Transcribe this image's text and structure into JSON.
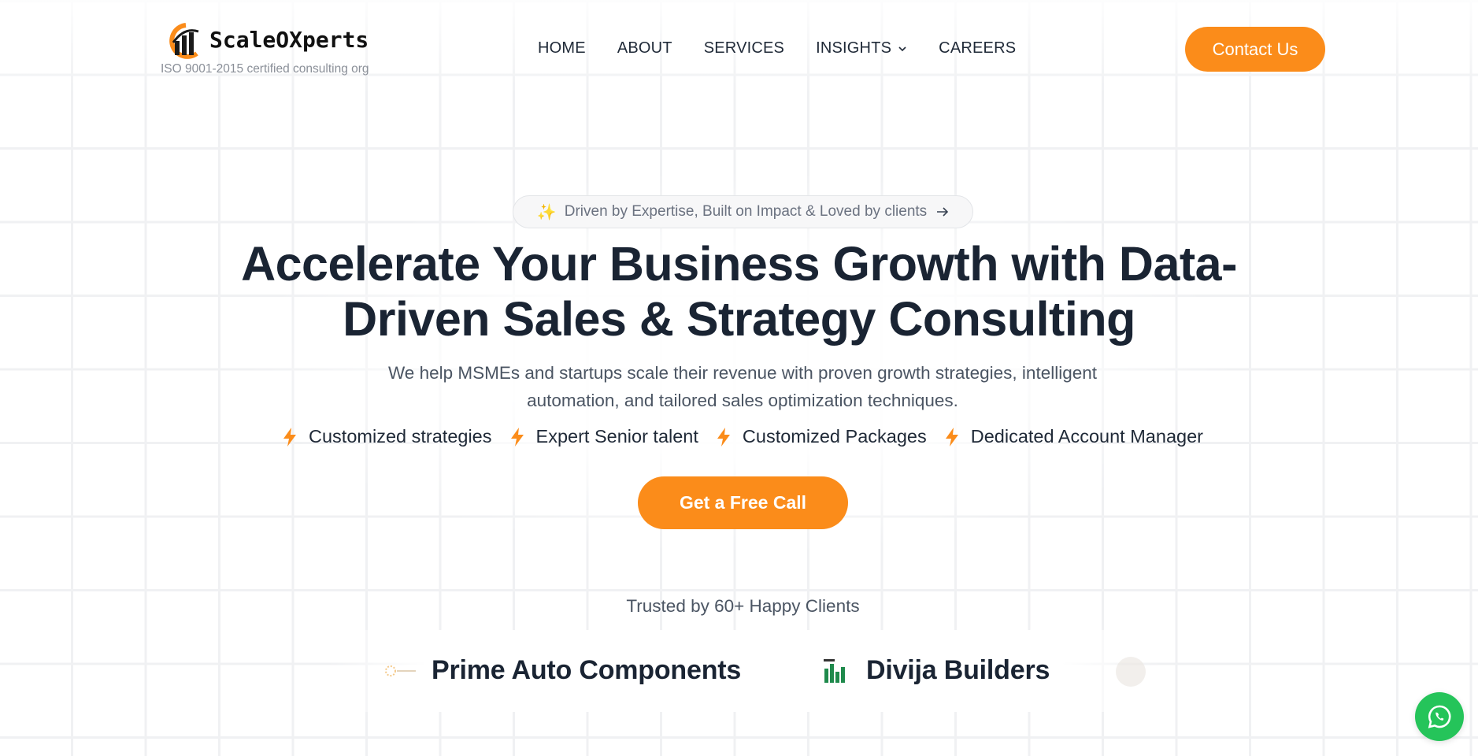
{
  "header": {
    "logo_text": "ScaleOXperts",
    "tagline": "ISO 9001-2015 certified consulting org",
    "nav": [
      {
        "label": "HOME"
      },
      {
        "label": "ABOUT"
      },
      {
        "label": "SERVICES"
      },
      {
        "label": "INSIGHTS",
        "has_dropdown": true
      },
      {
        "label": "CAREERS"
      }
    ],
    "contact_label": "Contact Us"
  },
  "hero": {
    "pill_text": "Driven by Expertise, Built on Impact & Loved by clients",
    "headline_line1": "Accelerate Your Business Growth with Data-",
    "headline_line2": "Driven Sales & Strategy Consulting",
    "subtext_line1": "We help MSMEs and startups scale their revenue with proven growth strategies, intelligent",
    "subtext_line2": "automation, and tailored sales optimization techniques.",
    "features": [
      {
        "label": "Customized strategies"
      },
      {
        "label": "Expert Senior talent"
      },
      {
        "label": "Customized Packages"
      },
      {
        "label": "Dedicated Account Manager"
      }
    ],
    "cta_label": "Get a Free Call"
  },
  "trusted": {
    "heading": "Trusted by 60+ Happy Clients",
    "clients": [
      {
        "name": "Prime Auto Components"
      },
      {
        "name": "Divija Builders"
      }
    ]
  },
  "colors": {
    "accent": "#fb8c1a",
    "heading": "#1a2433",
    "whatsapp": "#25c45a"
  },
  "icons": {
    "feature": "lightning-bolt-icon",
    "pill_lead": "sparkles-icon",
    "pill_trail": "arrow-right-icon",
    "chat": "whatsapp-icon"
  }
}
